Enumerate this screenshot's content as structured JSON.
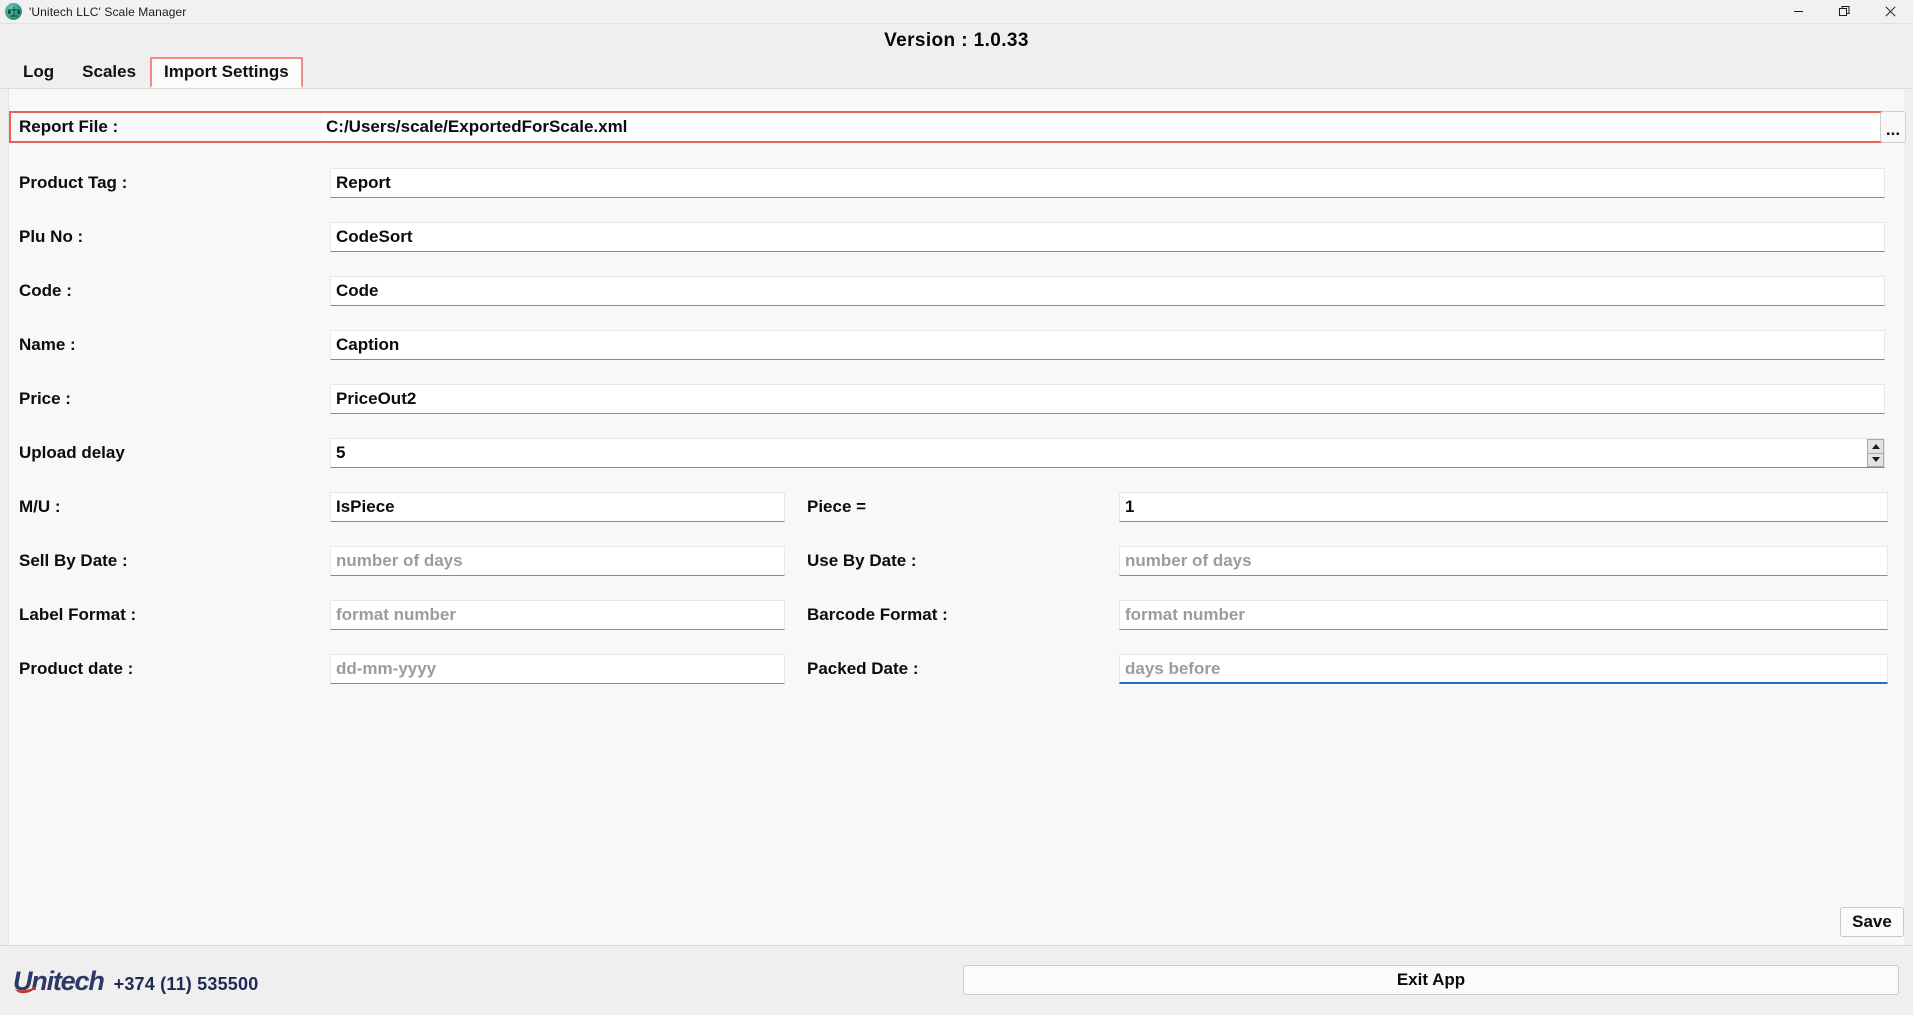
{
  "window": {
    "title": "'Unitech LLC' Scale Manager",
    "app_icon": "scale-balance-icon",
    "controls": {
      "minimize": "—",
      "maximize": "❐",
      "close": "✕"
    }
  },
  "header": {
    "version_label": "Version :",
    "version_value": "1.0.33",
    "version_text": "Version :    1.0.33"
  },
  "tabs": [
    {
      "label": "Log",
      "active": false
    },
    {
      "label": "Scales",
      "active": false
    },
    {
      "label": "Import Settings",
      "active": true
    }
  ],
  "form": {
    "report_file": {
      "label": "Report File :",
      "value": "C:/Users/scale/ExportedForScale.xml",
      "browse_label": "..."
    },
    "product_tag": {
      "label": "Product Tag :",
      "value": "Report"
    },
    "plu_no": {
      "label": "Plu No :",
      "value": "CodeSort"
    },
    "code": {
      "label": "Code :",
      "value": "Code"
    },
    "name": {
      "label": "Name :",
      "value": "Caption"
    },
    "price": {
      "label": "Price :",
      "value": "PriceOut2"
    },
    "upload_delay": {
      "label": "Upload delay",
      "value": "5"
    },
    "mu": {
      "label": "M/U :",
      "value": "IsPiece"
    },
    "piece": {
      "label": "Piece  =",
      "value": "1"
    },
    "sell_by_date": {
      "label": "Sell By Date :",
      "value": "",
      "placeholder": "number of days"
    },
    "use_by_date": {
      "label": "Use By Date  :",
      "value": "",
      "placeholder": "number of days"
    },
    "label_format": {
      "label": "Label Format :",
      "value": "",
      "placeholder": "format number"
    },
    "barcode_format": {
      "label": "Barcode Format :",
      "value": "",
      "placeholder": "format number"
    },
    "product_date": {
      "label": "Product date :",
      "value": "",
      "placeholder": "dd-mm-yyyy"
    },
    "packed_date": {
      "label": "Packed Date :",
      "value": "",
      "placeholder": "days before",
      "focused": true
    },
    "save_label": "Save"
  },
  "footer": {
    "logo_text": "Unitech",
    "phone": "+374 (11) 535500",
    "exit_label": "Exit App"
  },
  "colors": {
    "accent_red": "#e8625a",
    "focus_blue": "#1a73c8",
    "brand_navy": "#2b3a68",
    "brand_red": "#c0392b",
    "panel_bg": "#f8f8f8",
    "chrome_bg": "#f0eeef"
  }
}
